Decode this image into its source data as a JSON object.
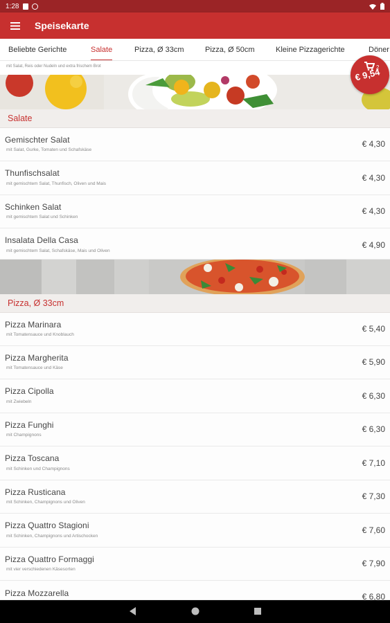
{
  "status": {
    "time": "1:28"
  },
  "app": {
    "title": "Speisekarte"
  },
  "tabs": [
    {
      "label": "Beliebte Gerichte"
    },
    {
      "label": "Salate"
    },
    {
      "label": "Pizza, Ø 33cm"
    },
    {
      "label": "Pizza, Ø 50cm"
    },
    {
      "label": "Kleine Pizzagerichte"
    },
    {
      "label": "Döner"
    }
  ],
  "prev_item_desc": "mit Salat, Reis oder Nudeln und extra frischem Brot",
  "sections": [
    {
      "title": "Salate",
      "items": [
        {
          "name": "Gemischter Salat",
          "desc": "mit Salat, Gurke, Tomaten und Schafskäse",
          "price": "€ 4,30"
        },
        {
          "name": "Thunfischsalat",
          "desc": "mit gemischtem Salat, Thunfisch, Oliven und Mais",
          "price": "€ 4,30"
        },
        {
          "name": "Schinken Salat",
          "desc": "mit gemischtem Salat und Schinken",
          "price": "€ 4,30"
        },
        {
          "name": "Insalata Della Casa",
          "desc": "mit gemischtem Salat, Schafskäse, Mais und Oliven",
          "price": "€ 4,90"
        }
      ]
    },
    {
      "title": "Pizza, Ø 33cm",
      "items": [
        {
          "name": "Pizza Marinara",
          "desc": "mit Tomatensauce und Knoblauch",
          "price": "€ 5,40"
        },
        {
          "name": "Pizza Margherita",
          "desc": "mit Tomatensauce und Käse",
          "price": "€ 5,90"
        },
        {
          "name": "Pizza Cipolla",
          "desc": "mit Zwiebeln",
          "price": "€ 6,30"
        },
        {
          "name": "Pizza Funghi",
          "desc": "mit Champignons",
          "price": "€ 6,30"
        },
        {
          "name": "Pizza Toscana",
          "desc": "mit Schinken und Champignons",
          "price": "€ 7,10"
        },
        {
          "name": "Pizza Rusticana",
          "desc": "mit Schinken, Champignons und Oliven",
          "price": "€ 7,30"
        },
        {
          "name": "Pizza Quattro Stagioni",
          "desc": "mit Schinken, Champignons und Artischocken",
          "price": "€ 7,60"
        },
        {
          "name": "Pizza Quattro Formaggi",
          "desc": "mit vier verschiedenen Käsesorten",
          "price": "€ 7,90"
        },
        {
          "name": "Pizza Mozzarella",
          "desc": "",
          "price": "€ 6,80"
        }
      ]
    }
  ],
  "cart": {
    "count": "2",
    "total": "€ 9,54"
  },
  "colors": {
    "primary": "#c7302f",
    "status_bar": "#9b2426",
    "section_bg": "#f1eeec"
  },
  "icons": [
    "menu-icon",
    "wifi-icon",
    "battery-icon",
    "cart-icon",
    "back-icon",
    "home-icon",
    "recents-icon"
  ]
}
